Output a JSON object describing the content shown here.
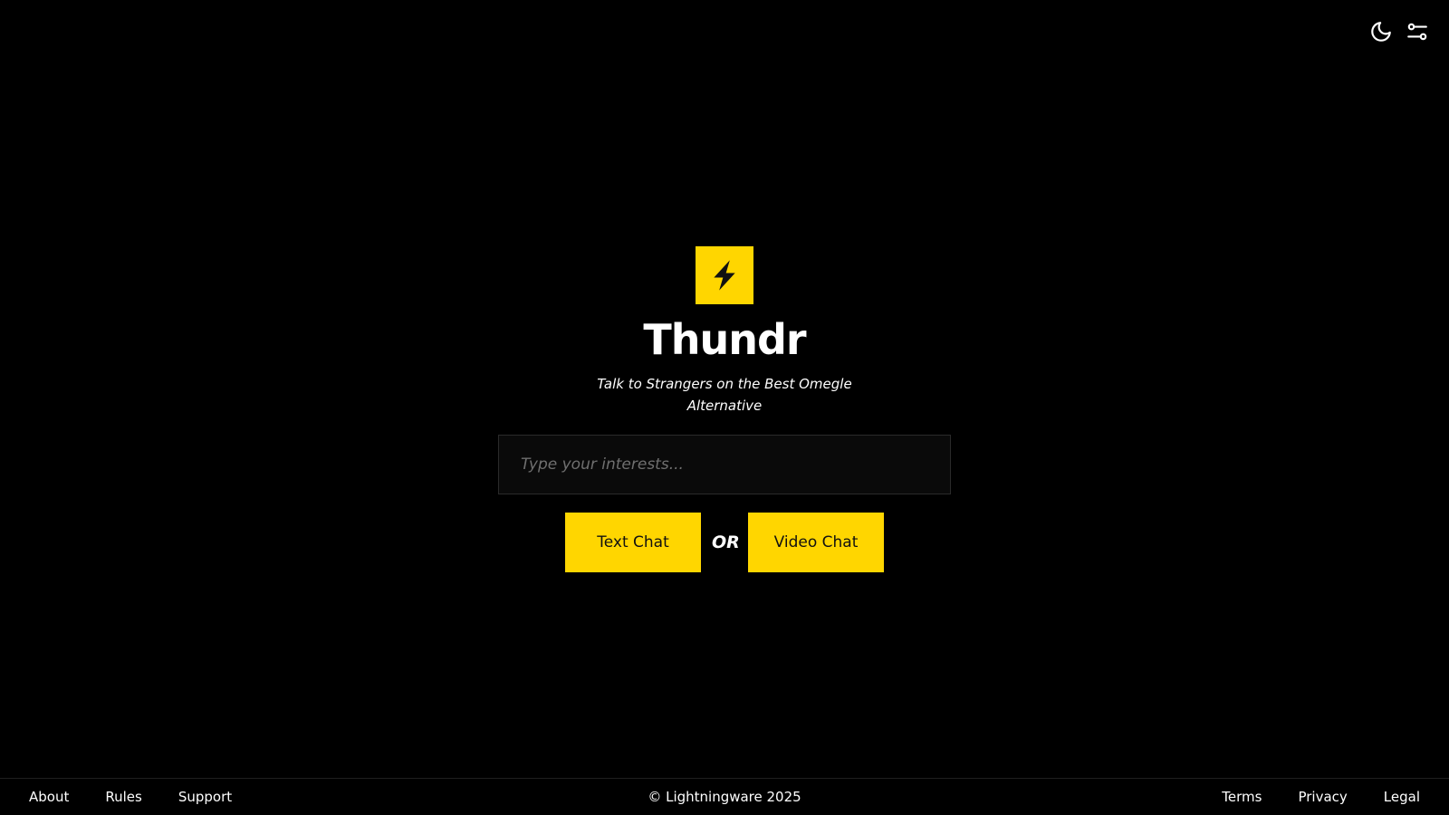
{
  "header": {
    "icons": [
      "moon-icon",
      "sliders-icon"
    ]
  },
  "brand": {
    "logo_icon": "lightning-bolt-icon",
    "name": "Thundr",
    "tagline": "Talk to Strangers on the Best Omegle Alternative",
    "accent_color": "#ffd600"
  },
  "interests": {
    "placeholder": "Type your interests...",
    "value": ""
  },
  "actions": {
    "text_chat_label": "Text Chat",
    "or_label": "OR",
    "video_chat_label": "Video Chat"
  },
  "footer": {
    "left_links": [
      "About",
      "Rules",
      "Support"
    ],
    "copyright": "© Lightningware 2025",
    "right_links": [
      "Terms",
      "Privacy",
      "Legal"
    ]
  }
}
